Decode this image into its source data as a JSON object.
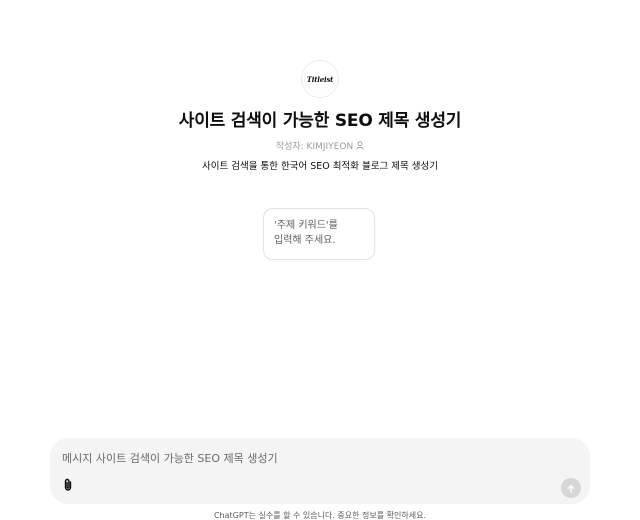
{
  "gpt": {
    "logo_text": "Titleist",
    "title": "사이트 검색이 가능한 SEO 제목 생성기",
    "author": "작성자: KIMJIYEON",
    "description": "사이트 검색을 통한 한국어 SEO 최적화 블로그 제목 생성기"
  },
  "conversation_starters": [
    {
      "label": "'주제 키워드'를\n입력해 주세요."
    }
  ],
  "composer": {
    "placeholder": "메시지 사이트 검색이 가능한 SEO 제목 생성기",
    "attach_icon": "paperclip-icon",
    "send_icon": "arrow-up-icon"
  },
  "footer": {
    "disclaimer": "ChatGPT는 실수를 할 수 있습니다. 중요한 정보를 확인하세요."
  },
  "colors": {
    "background": "#ffffff",
    "composer_bg": "#f4f4f4",
    "send_disabled": "#d7d7d7",
    "muted_text": "#9b9b9b"
  }
}
